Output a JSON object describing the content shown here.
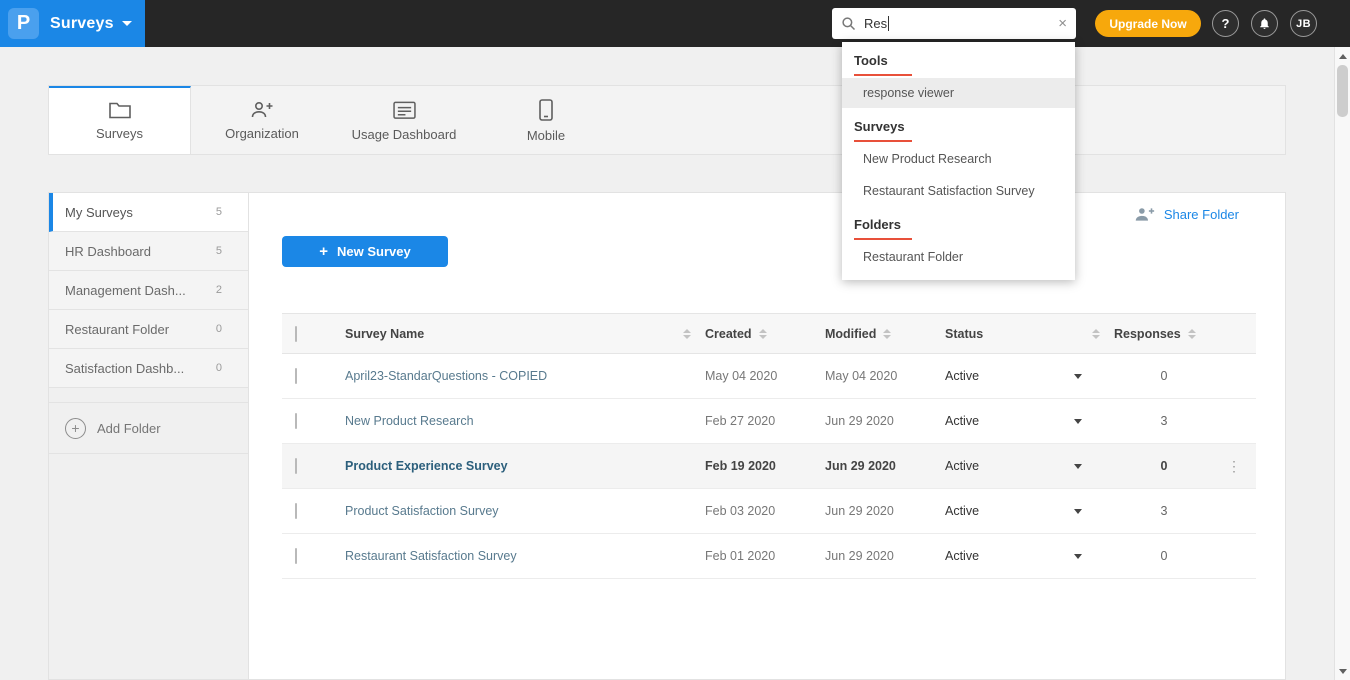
{
  "topbar": {
    "logo_letter": "P",
    "product_label": "Surveys",
    "search_value": "Res",
    "upgrade_label": "Upgrade Now",
    "avatar_initials": "JB"
  },
  "icons": {
    "clear": "×",
    "help": "?",
    "kebab": "⋮",
    "plus": "+"
  },
  "search_dropdown": {
    "sections": [
      {
        "title": "Tools"
      },
      {
        "title": "Surveys"
      },
      {
        "title": "Folders"
      }
    ],
    "tools_items": [
      "response viewer"
    ],
    "surveys_items": [
      "New Product Research",
      "Restaurant Satisfaction Survey"
    ],
    "folders_items": [
      "Restaurant Folder"
    ]
  },
  "tabs": [
    {
      "label": "Surveys"
    },
    {
      "label": "Organization"
    },
    {
      "label": "Usage Dashboard"
    },
    {
      "label": "Mobile"
    }
  ],
  "sidebar": {
    "items": [
      {
        "label": "My Surveys",
        "count": "5"
      },
      {
        "label": "HR Dashboard",
        "count": "5"
      },
      {
        "label": "Management Dash...",
        "count": "2"
      },
      {
        "label": "Restaurant Folder",
        "count": "0"
      },
      {
        "label": "Satisfaction Dashb...",
        "count": "0"
      }
    ],
    "add_folder_label": "Add Folder"
  },
  "content": {
    "share_folder_label": "Share Folder",
    "new_survey_label": "New Survey",
    "table": {
      "headers": [
        "Survey Name",
        "Created",
        "Modified",
        "Status",
        "Responses"
      ],
      "rows": [
        {
          "name": "April23-StandarQuestions - COPIED",
          "created": "May 04 2020",
          "modified": "May 04 2020",
          "status": "Active",
          "responses": "0"
        },
        {
          "name": "New Product Research",
          "created": "Feb 27 2020",
          "modified": "Jun 29 2020",
          "status": "Active",
          "responses": "3"
        },
        {
          "name": "Product Experience Survey",
          "created": "Feb 19 2020",
          "modified": "Jun 29 2020",
          "status": "Active",
          "responses": "0"
        },
        {
          "name": "Product Satisfaction Survey",
          "created": "Feb 03 2020",
          "modified": "Jun 29 2020",
          "status": "Active",
          "responses": "3"
        },
        {
          "name": "Restaurant Satisfaction Survey",
          "created": "Feb 01 2020",
          "modified": "Jun 29 2020",
          "status": "Active",
          "responses": "0"
        }
      ]
    }
  },
  "colors": {
    "accent": "#1b87e6",
    "upgrade_orange": "#f7a80c",
    "underline_red": "#e8503a",
    "topbar": "#262626"
  }
}
